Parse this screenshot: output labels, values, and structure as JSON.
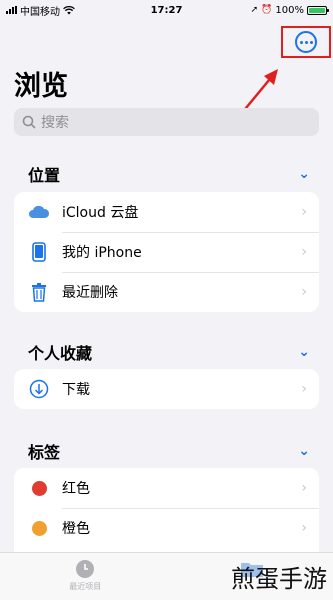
{
  "status": {
    "carrier": "中国移动",
    "time": "17:27",
    "battery": "100%",
    "battery_level": 1.0
  },
  "header": {
    "title": "浏览",
    "search_placeholder": "搜索"
  },
  "sections": {
    "locations": {
      "title": "位置",
      "items": [
        {
          "label": "iCloud 云盘",
          "icon": "cloud-icon"
        },
        {
          "label": "我的 iPhone",
          "icon": "phone-icon"
        },
        {
          "label": "最近删除",
          "icon": "trash-icon"
        }
      ]
    },
    "favorites": {
      "title": "个人收藏",
      "items": [
        {
          "label": "下载",
          "icon": "download-icon"
        }
      ]
    },
    "tags": {
      "title": "标签",
      "items": [
        {
          "label": "红色",
          "color": "#e03c31"
        },
        {
          "label": "橙色",
          "color": "#f0a030"
        }
      ]
    }
  },
  "tabbar": {
    "recents": "最近项目"
  },
  "watermark": "煎蛋手游",
  "colors": {
    "accent": "#1a73e8",
    "highlight": "#e02020"
  }
}
